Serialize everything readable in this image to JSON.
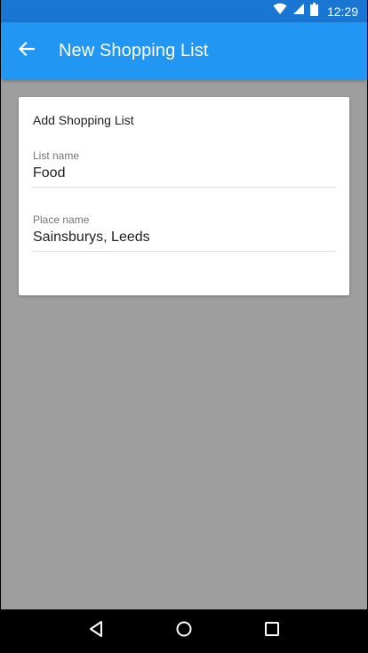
{
  "status_bar": {
    "time": "12:29",
    "icons": [
      "wifi-icon",
      "signal-icon",
      "battery-icon"
    ]
  },
  "app_bar": {
    "title": "New Shopping List",
    "back_icon": "arrow-back-icon"
  },
  "card": {
    "title": "Add Shopping List",
    "fields": [
      {
        "label": "List name",
        "value": "Food"
      },
      {
        "label": "Place name",
        "value": "Sainsburys, Leeds"
      }
    ]
  },
  "nav_bar": {
    "buttons": [
      "back-triangle-icon",
      "home-circle-icon",
      "recents-square-icon"
    ]
  },
  "colors": {
    "status_bar": "#1976d2",
    "app_bar": "#2196f3",
    "background": "#9e9e9e",
    "card": "#ffffff"
  }
}
